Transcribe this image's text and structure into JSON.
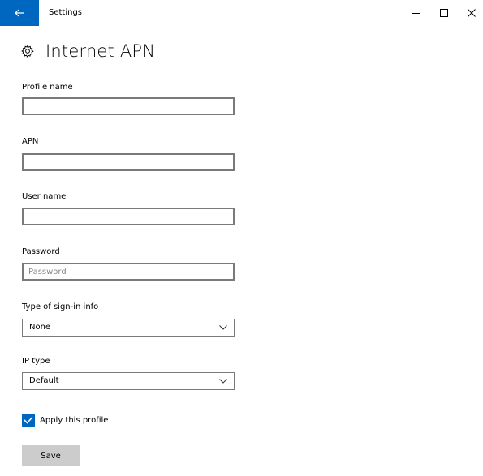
{
  "window": {
    "title": "Settings",
    "accent_color": "#0067c0",
    "icons": {
      "back": "back-arrow-icon",
      "minimize": "minimize-icon",
      "maximize": "maximize-icon",
      "close": "close-icon"
    }
  },
  "header": {
    "title": "Internet APN",
    "icon": "gear-icon"
  },
  "form": {
    "profile_name": {
      "label": "Profile name",
      "value": "",
      "placeholder": ""
    },
    "apn": {
      "label": "APN",
      "value": "",
      "placeholder": ""
    },
    "user_name": {
      "label": "User name",
      "value": "",
      "placeholder": ""
    },
    "password": {
      "label": "Password",
      "value": "",
      "placeholder": "Password"
    },
    "sign_in_type": {
      "label": "Type of sign-in info",
      "selected": "None"
    },
    "ip_type": {
      "label": "IP type",
      "selected": "Default"
    },
    "apply_profile": {
      "label": "Apply this profile",
      "checked": true
    },
    "save_label": "Save"
  }
}
